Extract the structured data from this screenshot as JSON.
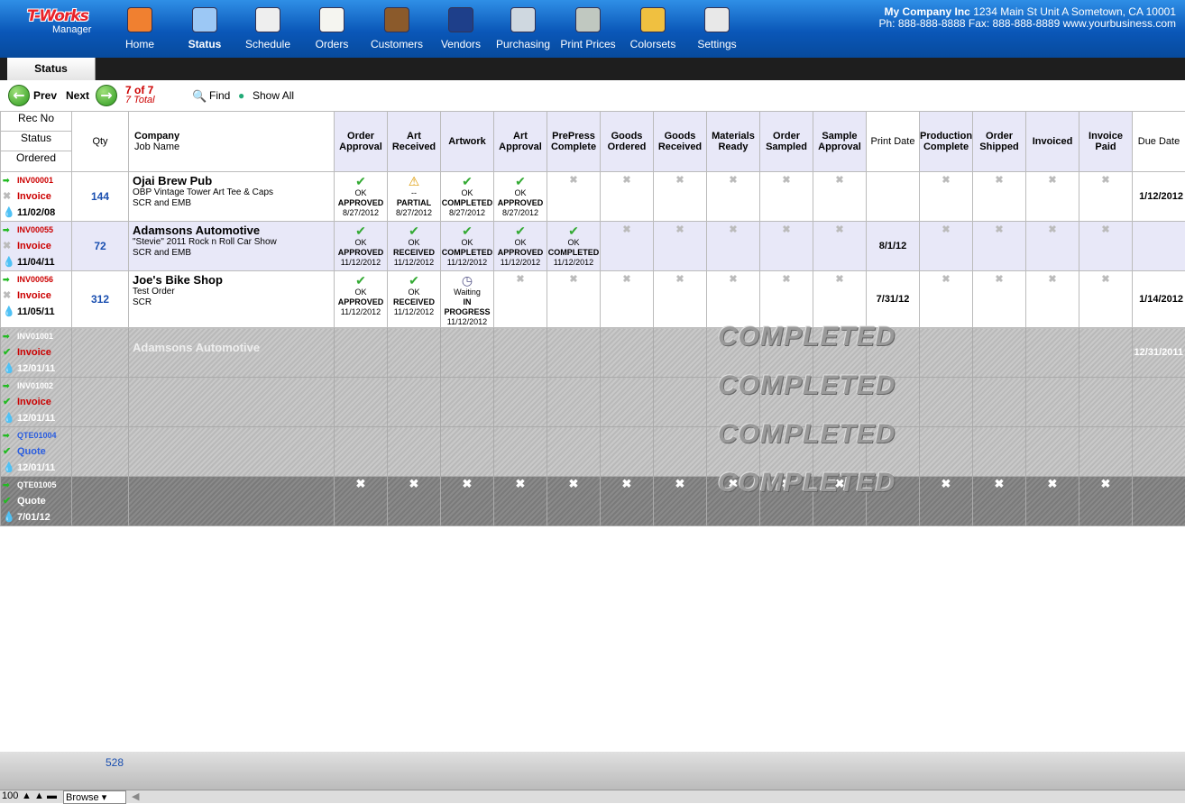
{
  "app": {
    "logo_top": "T-Works",
    "logo_bottom": "Manager"
  },
  "nav": [
    {
      "label": "Home",
      "icon": "home-icon",
      "color": "#f08030"
    },
    {
      "label": "Status",
      "icon": "flag-icon",
      "color": "#9cc8f5"
    },
    {
      "label": "Schedule",
      "icon": "calendar-icon",
      "color": "#eeeeee"
    },
    {
      "label": "Orders",
      "icon": "notepad-icon",
      "color": "#f5f5f0"
    },
    {
      "label": "Customers",
      "icon": "addressbook-icon",
      "color": "#8b5a2b"
    },
    {
      "label": "Vendors",
      "icon": "shirt-icon",
      "color": "#1e3f8a"
    },
    {
      "label": "Purchasing",
      "icon": "basket-icon",
      "color": "#cfd8e0"
    },
    {
      "label": "Print Prices",
      "icon": "calculator-icon",
      "color": "#c0c8c0"
    },
    {
      "label": "Colorsets",
      "icon": "palette-icon",
      "color": "#f0c040"
    },
    {
      "label": "Settings",
      "icon": "switch-icon",
      "color": "#e8e8e8"
    }
  ],
  "company": {
    "name": "My Company Inc",
    "address": "1234 Main St Unit A Sometown, CA 10001",
    "line2": "Ph: 888-888-8888 Fax: 888-888-8889 www.yourbusiness.com"
  },
  "tab": "Status",
  "toolbar": {
    "prev": "Prev",
    "next": "Next",
    "count": "7 of 7",
    "total": "7 Total",
    "find": "Find",
    "show_all": "Show All"
  },
  "headers": {
    "rec_no": "Rec No",
    "status": "Status",
    "ordered": "Ordered",
    "qty": "Qty",
    "company": "Company",
    "job": "Job Name",
    "cols": [
      "Order Approval",
      "Art Received",
      "Artwork",
      "Art Approval",
      "PrePress Complete",
      "Goods Ordered",
      "Goods Received",
      "Materials Ready",
      "Order Sampled",
      "Sample Approval",
      "Print Date",
      "Production Complete",
      "Order Shipped",
      "Invoiced",
      "Invoice Paid",
      "Due Date"
    ]
  },
  "rows": [
    {
      "rec": "INV00001",
      "status": "Invoice",
      "ordered": "11/02/08",
      "qty": "144",
      "company": "Ojai Brew Pub",
      "job1": "OBP Vintage Tower Art Tee & Caps",
      "job2": "SCR and EMB",
      "print": "",
      "due": "1/12/2012",
      "cells": [
        {
          "t": "OK",
          "s": "APPROVED",
          "d": "8/27/2012",
          "i": "check"
        },
        {
          "t": "--",
          "s": "PARTIAL",
          "d": "8/27/2012",
          "i": "warn"
        },
        {
          "t": "OK",
          "s": "COMPLETED",
          "d": "8/27/2012",
          "i": "check"
        },
        {
          "t": "OK",
          "s": "APPROVED",
          "d": "8/27/2012",
          "i": "check"
        }
      ]
    },
    {
      "rec": "INV00055",
      "status": "Invoice",
      "ordered": "11/04/11",
      "qty": "72",
      "company": "Adamsons Automotive",
      "job1": "\"Stevie\" 2011 Rock n Roll Car Show",
      "job2": "SCR and EMB",
      "print": "8/1/12",
      "due": "",
      "cells": [
        {
          "t": "OK",
          "s": "APPROVED",
          "d": "11/12/2012",
          "i": "check"
        },
        {
          "t": "OK",
          "s": "RECEIVED",
          "d": "11/12/2012",
          "i": "check"
        },
        {
          "t": "OK",
          "s": "COMPLETED",
          "d": "11/12/2012",
          "i": "check"
        },
        {
          "t": "OK",
          "s": "APPROVED",
          "d": "11/12/2012",
          "i": "check"
        },
        {
          "t": "OK",
          "s": "COMPLETED",
          "d": "11/12/2012",
          "i": "check"
        }
      ]
    },
    {
      "rec": "INV00056",
      "status": "Invoice",
      "ordered": "11/05/11",
      "qty": "312",
      "company": "Joe's Bike Shop",
      "job1": "Test Order",
      "job2": "SCR",
      "print": "7/31/12",
      "due": "1/14/2012",
      "cells": [
        {
          "t": "OK",
          "s": "APPROVED",
          "d": "11/12/2012",
          "i": "check"
        },
        {
          "t": "OK",
          "s": "RECEIVED",
          "d": "11/12/2012",
          "i": "check"
        },
        {
          "t": "Waiting",
          "s": "IN PROGRESS",
          "d": "11/12/2012",
          "i": "clock"
        }
      ]
    },
    {
      "rec": "INV01001",
      "status": "Invoice",
      "ordered": "12/01/11",
      "company": "Adamsons Automotive",
      "due": "12/31/2011",
      "completed": "COMPLETED"
    },
    {
      "rec": "INV01002",
      "status": "Invoice",
      "ordered": "12/01/11",
      "company": "",
      "due": "",
      "completed": "COMPLETED"
    },
    {
      "rec": "QTE01004",
      "status": "Quote",
      "ordered": "12/01/11",
      "company": "",
      "due": "",
      "completed": "COMPLETED"
    },
    {
      "rec": "QTE01005",
      "status": "Quote",
      "ordered": "7/01/12",
      "company": "",
      "due": "",
      "completed": "COMPLETED"
    }
  ],
  "footer": {
    "qty_total": "528"
  },
  "statusbar": {
    "zoom": "100",
    "mode": "Browse"
  }
}
